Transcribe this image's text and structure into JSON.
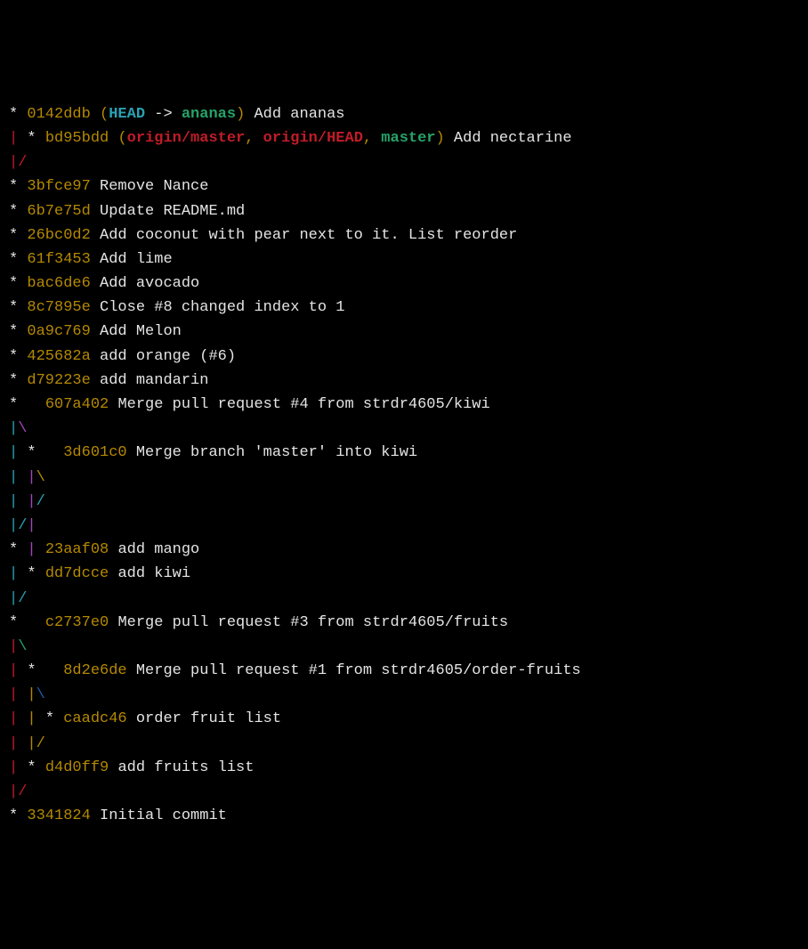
{
  "colors": {
    "bg": "#000000",
    "fg": "#e4e4e4",
    "hash": "#b58900",
    "head": "#2aa1b3",
    "branch": "#26a269",
    "remote": "#c01c28",
    "graphRed": "#c01c28",
    "graphCyan": "#2aa1b3",
    "graphMagenta": "#a347ba",
    "graphYellow": "#b58900",
    "graphGreen": "#26a269",
    "graphBlue": "#1a5fb4"
  },
  "refs": {
    "head_label": "HEAD",
    "arrow": " -> ",
    "current_branch": "ananas",
    "origin_master": "origin/master",
    "origin_head": "origin/HEAD",
    "master": "master"
  },
  "commits": {
    "c0": {
      "hash": "0142ddb",
      "msg": "Add ananas"
    },
    "c1": {
      "hash": "bd95bdd",
      "msg": "Add nectarine"
    },
    "c2": {
      "hash": "3bfce97",
      "msg": "Remove Nance"
    },
    "c3": {
      "hash": "6b7e75d",
      "msg": "Update README.md"
    },
    "c4": {
      "hash": "26bc0d2",
      "msg": "Add coconut with pear next to it. List reorder"
    },
    "c5": {
      "hash": "61f3453",
      "msg": "Add lime"
    },
    "c6": {
      "hash": "bac6de6",
      "msg": "Add avocado"
    },
    "c7": {
      "hash": "8c7895e",
      "msg": "Close #8 changed index to 1"
    },
    "c8": {
      "hash": "0a9c769",
      "msg": "Add Melon"
    },
    "c9": {
      "hash": "425682a",
      "msg": "add orange (#6)"
    },
    "c10": {
      "hash": "d79223e",
      "msg": "add mandarin"
    },
    "c11": {
      "hash": "607a402",
      "msg": "Merge pull request #4 from strdr4605/kiwi"
    },
    "c12": {
      "hash": "3d601c0",
      "msg": "Merge branch 'master' into kiwi"
    },
    "c13": {
      "hash": "23aaf08",
      "msg": "add mango"
    },
    "c14": {
      "hash": "dd7dcce",
      "msg": "add kiwi"
    },
    "c15": {
      "hash": "c2737e0",
      "msg": "Merge pull request #3 from strdr4605/fruits"
    },
    "c16": {
      "hash": "8d2e6de",
      "msg": "Merge pull request #1 from strdr4605/order-fruits"
    },
    "c17": {
      "hash": "caadc46",
      "msg": "order fruit list"
    },
    "c18": {
      "hash": "d4d0ff9",
      "msg": "add fruits list"
    },
    "c19": {
      "hash": "3341824",
      "msg": "Initial commit"
    }
  },
  "graph": {
    "l0": {
      "pre": "* "
    },
    "l1": {
      "pre_a": "|",
      "pre_b": " * "
    },
    "l2": {
      "a": "|",
      "b": "/"
    },
    "l3": {
      "pre": "* "
    },
    "l4": {
      "pre": "* "
    },
    "l5": {
      "pre": "* "
    },
    "l6": {
      "pre": "* "
    },
    "l7": {
      "pre": "* "
    },
    "l8": {
      "pre": "* "
    },
    "l9": {
      "pre": "* "
    },
    "l10": {
      "pre": "* "
    },
    "l11": {
      "pre": "* "
    },
    "l12": {
      "pre": "*   "
    },
    "l13": {
      "a": "|",
      "b": "\\"
    },
    "l14": {
      "a": "| ",
      "b": "*   "
    },
    "l15": {
      "a": "| ",
      "b": "|",
      "c": "\\"
    },
    "l16": {
      "a": "| ",
      "b": "|",
      "c": "/"
    },
    "l17": {
      "a": "|",
      "b": "/",
      "c": "|"
    },
    "l18": {
      "a": "* ",
      "b": "| "
    },
    "l19": {
      "a": "| ",
      "b": "* "
    },
    "l20": {
      "a": "|",
      "b": "/"
    },
    "l21": {
      "pre": "*   "
    },
    "l22": {
      "a": "|",
      "b": "\\"
    },
    "l23": {
      "a": "| ",
      "b": "*   "
    },
    "l24": {
      "a": "| ",
      "b": "|",
      "c": "\\"
    },
    "l25": {
      "a": "| ",
      "b": "| ",
      "c": "* "
    },
    "l26": {
      "a": "| ",
      "b": "|",
      "c": "/"
    },
    "l27": {
      "a": "| ",
      "b": "* "
    },
    "l28": {
      "a": "|",
      "b": "/"
    },
    "l29": {
      "pre": "* "
    }
  }
}
